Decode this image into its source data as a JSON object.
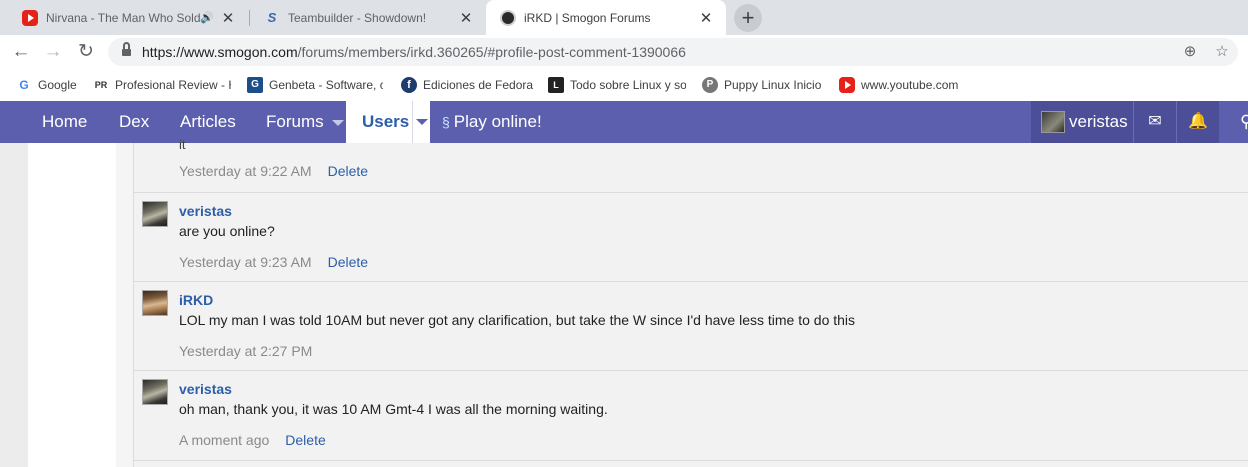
{
  "browser": {
    "tabs": [
      {
        "title": "Nirvana - The Man Who Sold",
        "icon": "youtube-icon",
        "audio": true
      },
      {
        "title": "Teambuilder - Showdown!",
        "icon": "showdown-icon"
      },
      {
        "title": "iRKD | Smogon Forums",
        "icon": "smogon-icon",
        "active": true
      }
    ],
    "new_tab_label": "+",
    "address": {
      "host": "https://www.smogon.com",
      "path": "/forums/members/irkd.360265/#profile-post-comment-1390066"
    },
    "bookmarks": [
      {
        "label": "Google",
        "icon": "google-icon",
        "glyph": "G"
      },
      {
        "label": "Profesional Review - Ha",
        "icon": "profesional-review-icon",
        "glyph": "PR"
      },
      {
        "label": "Genbeta - Software, c",
        "icon": "genbeta-icon",
        "glyph": "G"
      },
      {
        "label": "Ediciones de Fedora",
        "icon": "fedora-icon",
        "glyph": "f"
      },
      {
        "label": "Todo sobre Linux y so",
        "icon": "linux-icon",
        "glyph": "L"
      },
      {
        "label": "Puppy Linux Inicio",
        "icon": "puppy-icon",
        "glyph": "P"
      },
      {
        "label": "www.youtube.com",
        "icon": "youtube-icon",
        "glyph": ""
      }
    ]
  },
  "site_nav": {
    "items": [
      {
        "label": "Home"
      },
      {
        "label": "Dex"
      },
      {
        "label": "Articles"
      },
      {
        "label": "Forums"
      },
      {
        "label": "Users"
      },
      {
        "label": "Play online!"
      }
    ],
    "account_name": "veristas",
    "accent_color": "#5c5fad"
  },
  "partial_text": "it",
  "comments": [
    {
      "author": "",
      "text": "",
      "time": "Yesterday at 9:22 AM",
      "action": "Delete"
    },
    {
      "author": "veristas",
      "text": "are you online?",
      "time": "Yesterday at 9:23 AM",
      "action": "Delete"
    },
    {
      "author": "iRKD",
      "text": "LOL my man I was told 10AM but never got any clarification, but take the W since I'd have less time to do this",
      "time": "Yesterday at 2:27 PM",
      "action": ""
    },
    {
      "author": "veristas",
      "text": "oh man, thank you, it was 10 AM Gmt-4 I was all the morning waiting.",
      "time": "A moment ago",
      "action": "Delete"
    }
  ]
}
